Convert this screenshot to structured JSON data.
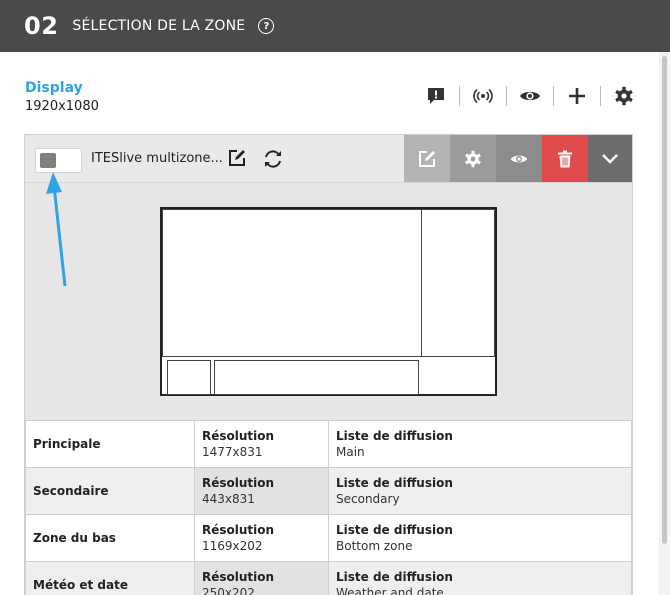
{
  "header": {
    "step_number": "02",
    "title": "SÉLECTION DE LA ZONE",
    "help_symbol": "?"
  },
  "display": {
    "name": "Display",
    "resolution": "1920x1080"
  },
  "toolbar": {
    "icons": [
      "alert-icon",
      "broadcast-icon",
      "eye-icon",
      "plus-icon",
      "gear-icon"
    ]
  },
  "zone_card": {
    "name": "ITESlive multizone...",
    "actions": [
      "edit",
      "settings",
      "preview",
      "delete",
      "expand"
    ],
    "action_colors": {
      "edit": "#b3b3b3",
      "settings": "#9b9b9b",
      "preview": "#8c8c8c",
      "delete": "#e14b4b",
      "expand": "#6d6d6d"
    }
  },
  "annotation": {
    "arrow_color": "#2ea3e6"
  },
  "zones_table": {
    "resolution_label": "Résolution",
    "playlist_label": "Liste de diffusion",
    "rows": [
      {
        "name": "Principale",
        "resolution": "1477x831",
        "playlist": "Main"
      },
      {
        "name": "Secondaire",
        "resolution": "443x831",
        "playlist": "Secondary"
      },
      {
        "name": "Zone du bas",
        "resolution": "1169x202",
        "playlist": "Bottom zone"
      },
      {
        "name": "Météo et date",
        "resolution": "250x202",
        "playlist": "Weather and date"
      }
    ]
  },
  "colors": {
    "accent": "#2ea3e6",
    "header_bg": "#4a4a4a",
    "delete": "#e14b4b"
  }
}
